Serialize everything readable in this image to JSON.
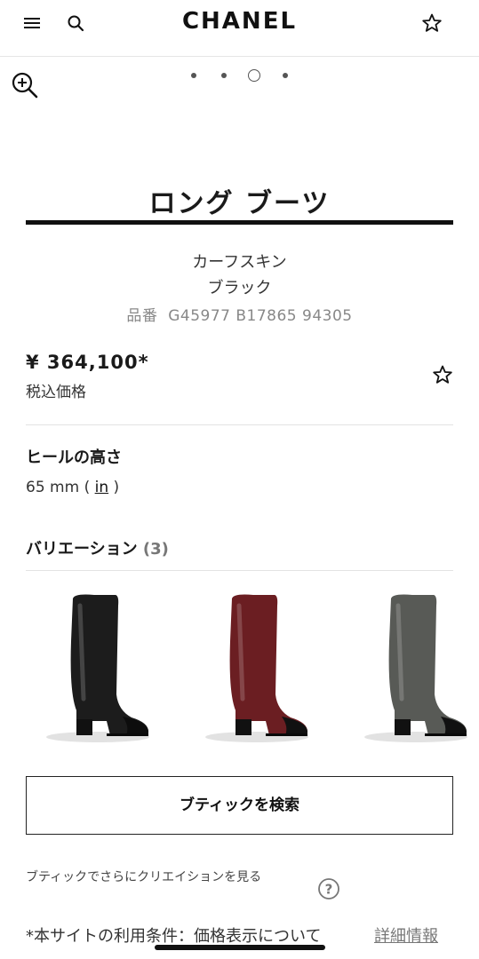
{
  "header": {
    "logo": "CHANEL",
    "icons": [
      "menu-icon",
      "search-icon",
      "star-icon"
    ]
  },
  "gallery": {
    "image_count": 4,
    "active_index": 2,
    "zoom_icon": "zoom-in-icon"
  },
  "product": {
    "title": "ロング ブーツ",
    "material": "カーフスキン",
    "color": "ブラック",
    "ref_label": "品番",
    "ref_code": "G45977 B17865 94305",
    "price": "¥ 364,100*",
    "tax_label": "税込価格"
  },
  "heel": {
    "label": "ヒールの高さ",
    "value": "65 mm",
    "open_paren": "(",
    "unit_link": "in",
    "close_paren": ")"
  },
  "variations": {
    "label": "バリエーション",
    "count": "(3)",
    "items": [
      {
        "name": "black",
        "color": "#1c1c1c",
        "toe": "#0d0d0d"
      },
      {
        "name": "burgundy",
        "color": "#6b1e22",
        "toe": "#111111"
      },
      {
        "name": "grey",
        "color": "#585a56",
        "toe": "#111111"
      }
    ]
  },
  "actions": {
    "search_boutique": "ブティックを検索"
  },
  "footer": {
    "boutique_note": "ブティックでさらにクリエイションを見る",
    "terms_text": "*本サイトの利用条件：価格表示について",
    "terms_link": "詳細情報"
  },
  "colors": {
    "text": "#1a1a1a",
    "muted": "#888888",
    "divider": "#e3e3e3"
  }
}
